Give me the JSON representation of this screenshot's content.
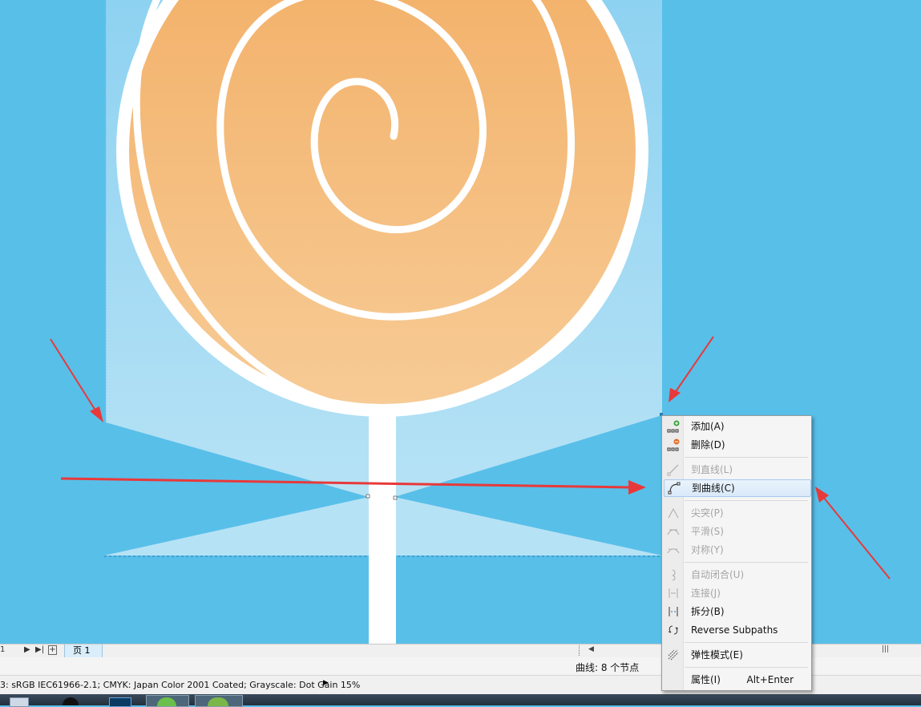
{
  "page_tabs": {
    "page_number": "1",
    "tab_label": "页 1"
  },
  "info_bar": {
    "selection_info": "曲线: 8 个节点"
  },
  "status_bar": {
    "color_profile": "3: sRGB IEC61966-2.1; CMYK: Japan Color 2001 Coated; Grayscale: Dot Gain 15%"
  },
  "context_menu": {
    "items": [
      {
        "label": "添加(A)",
        "icon": "add-node-icon",
        "enabled": true
      },
      {
        "label": "删除(D)",
        "icon": "delete-node-icon",
        "enabled": true
      },
      {
        "label": "到直线(L)",
        "icon": "to-line-icon",
        "enabled": false
      },
      {
        "label": "到曲线(C)",
        "icon": "to-curve-icon",
        "enabled": true,
        "highlighted": true
      },
      {
        "label": "尖突(P)",
        "icon": "cusp-icon",
        "enabled": false
      },
      {
        "label": "平滑(S)",
        "icon": "smooth-icon",
        "enabled": false
      },
      {
        "label": "对称(Y)",
        "icon": "symmetrical-icon",
        "enabled": false
      },
      {
        "label": "自动闭合(U)",
        "icon": "auto-close-icon",
        "enabled": false
      },
      {
        "label": "连接(J)",
        "icon": "join-icon",
        "enabled": false
      },
      {
        "label": "拆分(B)",
        "icon": "break-icon",
        "enabled": true
      },
      {
        "label": "Reverse Subpaths",
        "icon": "reverse-subpaths-icon",
        "enabled": true
      },
      {
        "label": "弹性模式(E)",
        "icon": "elastic-mode-icon",
        "enabled": true
      },
      {
        "label": "属性(I)",
        "icon": "",
        "enabled": true,
        "shortcut": "Alt+Enter"
      }
    ]
  },
  "colors": {
    "canvas_bg": "#58bfe9",
    "lollipop_top": "#f2ad63",
    "lollipop_bottom": "#f6c88f",
    "annotation_arrow": "#e8393a",
    "light_panel": "#a9dcf3"
  }
}
